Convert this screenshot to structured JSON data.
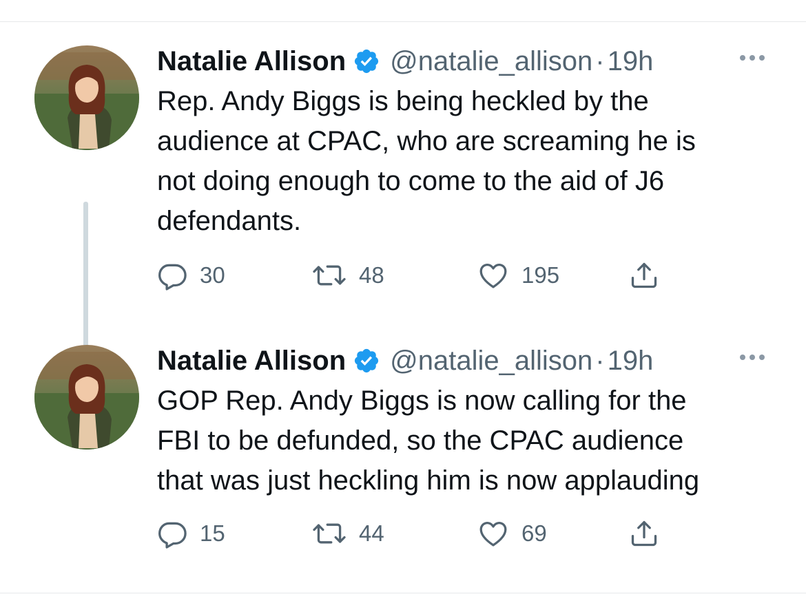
{
  "thread": {
    "tweets": [
      {
        "author": {
          "display_name": "Natalie Allison",
          "handle": "@natalie_allison",
          "verified": true
        },
        "separator": "·",
        "timestamp": "19h",
        "text_lines": [
          "Rep. Andy Biggs is being heckled by the",
          "audience at CPAC, who are screaming he is",
          "not doing enough to come to the aid of J6",
          "defendants."
        ],
        "stats": {
          "replies": "30",
          "retweets": "48",
          "likes": "195"
        }
      },
      {
        "author": {
          "display_name": "Natalie Allison",
          "handle": "@natalie_allison",
          "verified": true
        },
        "separator": "·",
        "timestamp": "19h",
        "text_lines": [
          "GOP Rep. Andy Biggs is now calling for the",
          "FBI to be defunded, so the CPAC audience",
          "that was just heckling him is now applauding"
        ],
        "stats": {
          "replies": "15",
          "retweets": "44",
          "likes": "69"
        }
      }
    ]
  },
  "icons": {
    "verified": "verified-badge-icon",
    "more": "more-options-icon",
    "reply": "reply-icon",
    "retweet": "retweet-icon",
    "like": "heart-icon",
    "share": "share-icon"
  },
  "colors": {
    "verified_blue": "#1d9bf0",
    "text_primary": "#0f1419",
    "text_secondary": "#536471",
    "thread_line": "#cfd9de"
  }
}
